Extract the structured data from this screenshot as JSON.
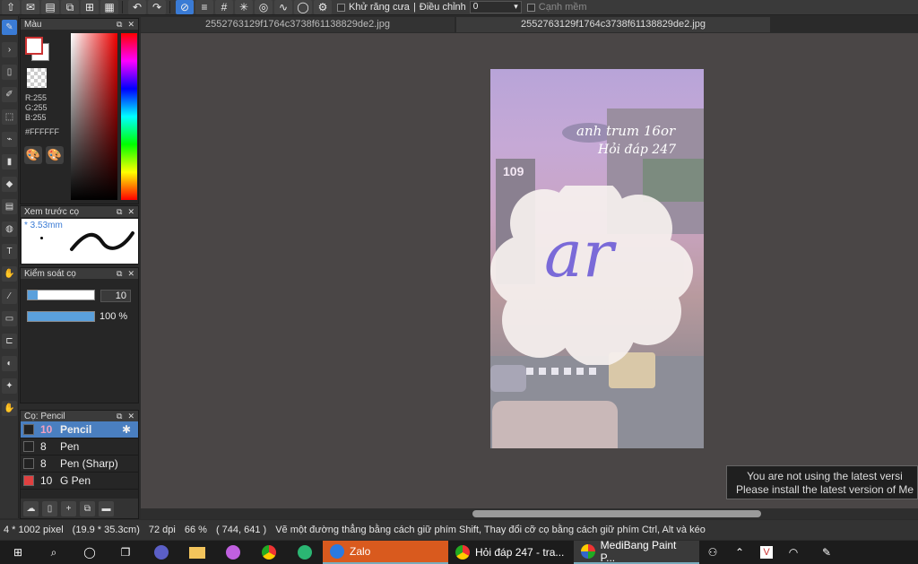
{
  "toolbar": {
    "antialias_label": "Khử răng cưa",
    "adjust_label": "Điều chỉnh",
    "adjust_value": "0",
    "smooth_label": "Cạnh mềm"
  },
  "panels": {
    "color": {
      "title": "Màu",
      "r": "R:255",
      "g": "G:255",
      "b": "B:255",
      "hex": "#FFFFFF"
    },
    "preview": {
      "title": "Xem trước cọ",
      "size": "* 3.53mm"
    },
    "control": {
      "title": "Kiểm soát cọ",
      "size_value": "10",
      "opacity_value": "100 %",
      "size_fraction": 0.15,
      "opacity_fraction": 1.0
    },
    "brush": {
      "title": "Cọ: Pencil",
      "items": [
        {
          "size": "10",
          "name": "Pencil",
          "color": "#222222"
        },
        {
          "size": "8",
          "name": "Pen",
          "color": "#222222"
        },
        {
          "size": "8",
          "name": "Pen (Sharp)",
          "color": "#222222"
        },
        {
          "size": "10",
          "name": "G Pen",
          "color": "#e04040"
        }
      ]
    }
  },
  "tabs": [
    {
      "label": "2552763129f1764c3738f61138829de2.jpg"
    },
    {
      "label": "2552763129f1764c3738f61138829de2.jpg"
    }
  ],
  "notice": {
    "line1": "You are not using the latest versi",
    "line2": "Please install the latest version of Me"
  },
  "status": {
    "size": "4 * 1002 pixel",
    "physical": "(19.9 * 35.3cm)",
    "dpi": "72 dpi",
    "zoom": "66 %",
    "coords": "( 744, 641 )",
    "hint": "Vẽ một đường thẳng bằng cách giữ phím Shift, Thay đổi cỡ cọ bằng cách giữ phím Ctrl, Alt và kéo"
  },
  "taskbar": {
    "zalo": "Zalo",
    "chrome_tab": "Hỏi đáp 247 - tra...",
    "medibang": "MediBang Paint P..."
  },
  "artwork": {
    "sign_line1": "anh trum 16or",
    "sign_line2": "Hỏi đáp 247",
    "building_label": "109",
    "letter": "ar"
  }
}
